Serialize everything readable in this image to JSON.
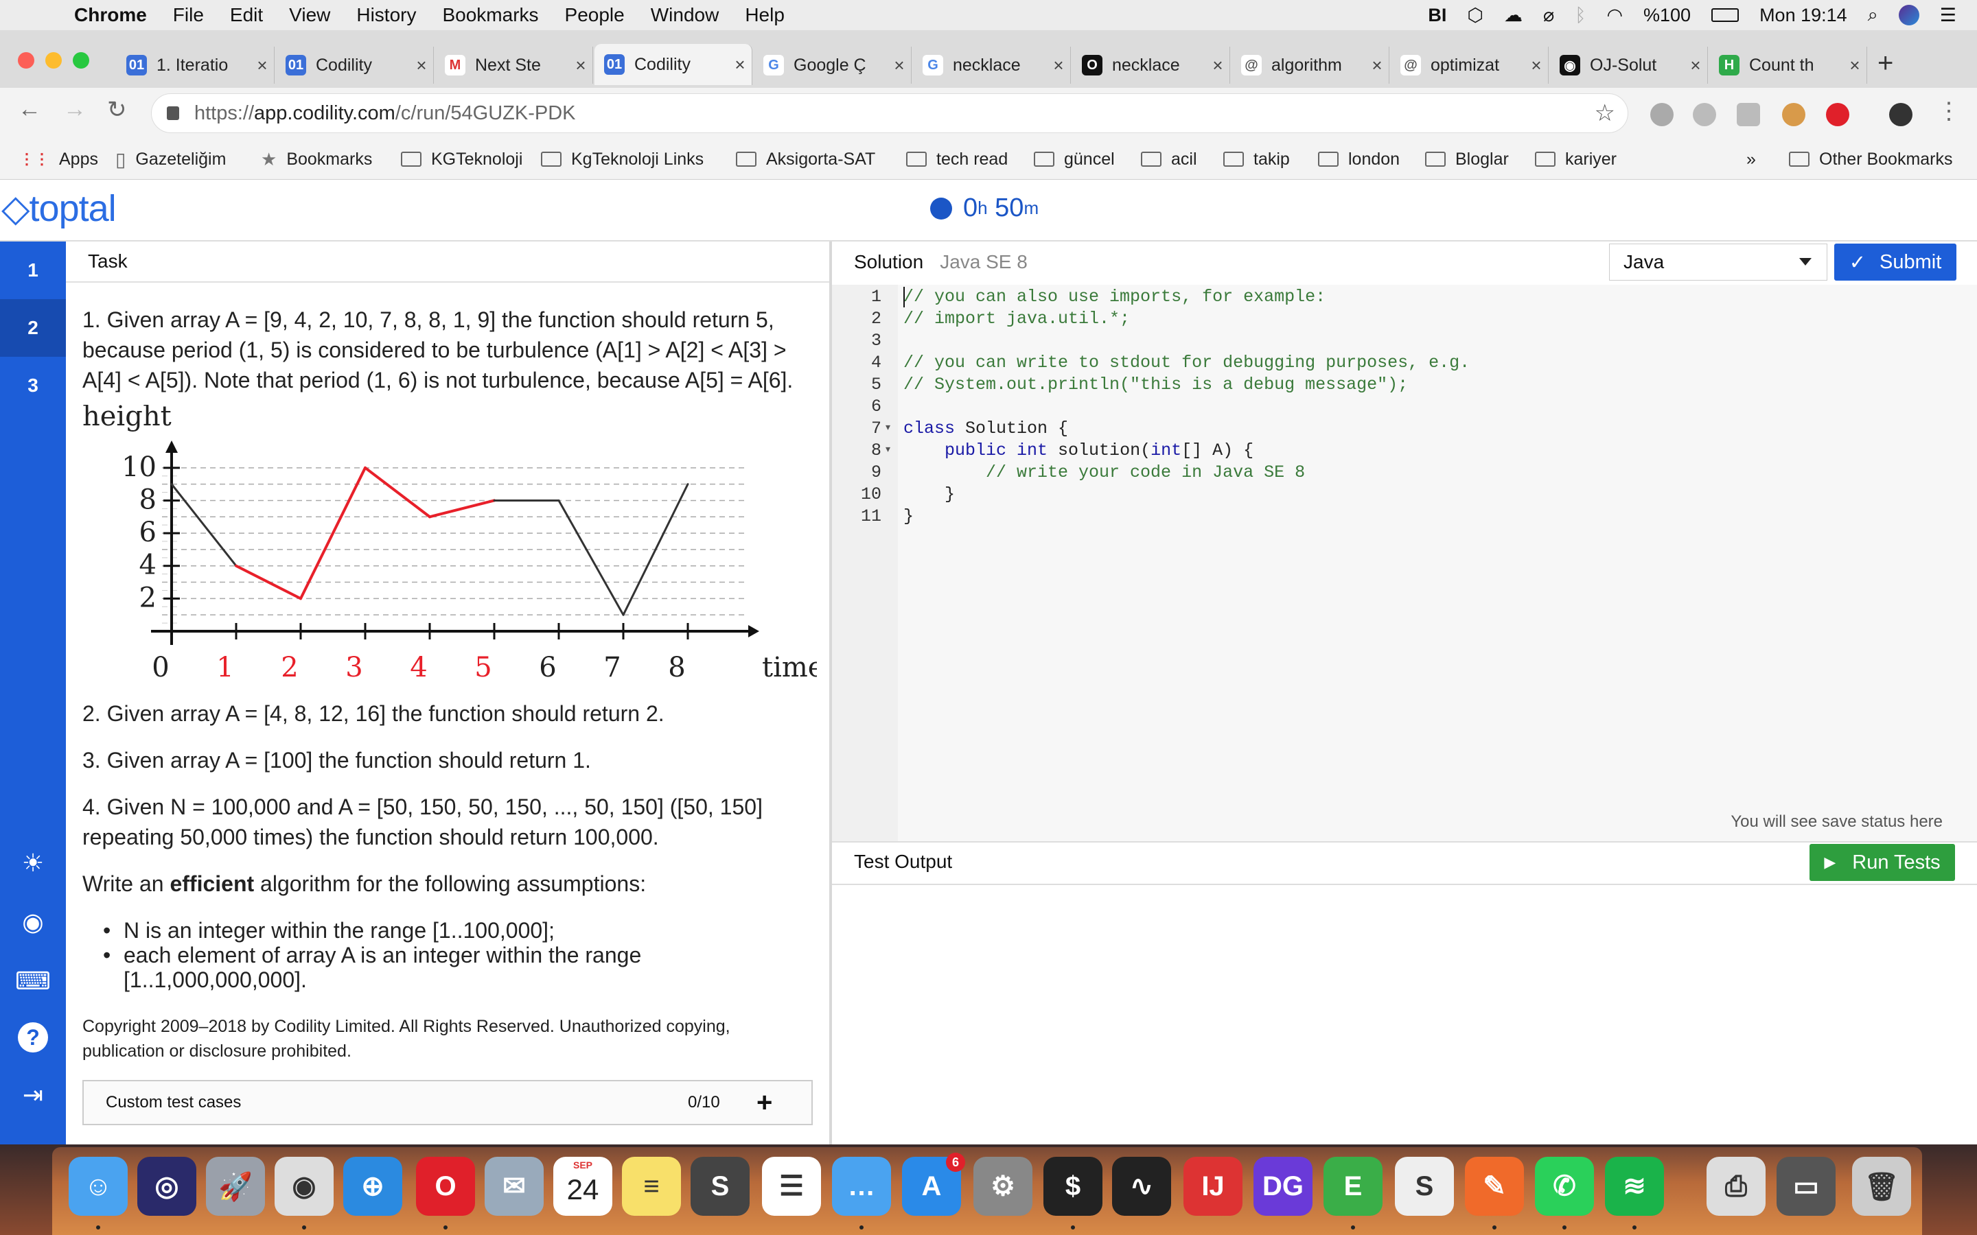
{
  "menubar": {
    "app": "Chrome",
    "items": [
      "File",
      "Edit",
      "View",
      "History",
      "Bookmarks",
      "People",
      "Window",
      "Help"
    ],
    "battery": "%100",
    "clock": "Mon 19:14"
  },
  "tabs": [
    {
      "label": "1. Iteratio",
      "icon": "01"
    },
    {
      "label": "Codility",
      "icon": "01"
    },
    {
      "label": "Next Ste",
      "icon": "M"
    },
    {
      "label": "Codility",
      "icon": "01"
    },
    {
      "label": "Google Ç",
      "icon": "G"
    },
    {
      "label": "necklace",
      "icon": "G"
    },
    {
      "label": "necklace",
      "icon": "O"
    },
    {
      "label": "algorithm",
      "icon": "@"
    },
    {
      "label": "optimizat",
      "icon": "@"
    },
    {
      "label": "OJ-Solut",
      "icon": "gh"
    },
    {
      "label": "Count th",
      "icon": "H"
    }
  ],
  "address": {
    "scheme": "https://",
    "host": "app.codility.com",
    "path": "/c/run/54GUZK-PDK"
  },
  "bookmarks": [
    "Apps",
    "Gazeteliğim",
    "Bookmarks",
    "KGTeknoloji",
    "KgTeknoloji Links",
    "Aksigorta-SAT",
    "tech read",
    "güncel",
    "acil",
    "takip",
    "london",
    "Bloglar",
    "kariyer"
  ],
  "bookmarks_more": "»",
  "bookmarks_other": "Other Bookmarks",
  "brand": "toptal",
  "timer": {
    "h": "0",
    "h_unit": "h",
    "m": "50",
    "m_unit": "m"
  },
  "sidebar": {
    "tasks": [
      "1",
      "2",
      "3"
    ]
  },
  "task": {
    "heading": "Task",
    "p1": "1. Given array A = [9, 4, 2, 10, 7, 8, 8, 1, 9] the function should return 5, because period (1, 5) is considered to be turbulence (A[1] > A[2] < A[3] > A[4] < A[5]). Note that period (1, 6) is not turbulence, because A[5] = A[6].",
    "p2": "2. Given array A = [4, 8, 12, 16] the function should return 2.",
    "p3": "3. Given array A = [100] the function should return 1.",
    "p4": "4. Given N = 100,000 and A = [50, 150, 50, 150, ..., 50, 150] ([50, 150] repeating 50,000 times) the function should return 100,000.",
    "p5_pre": "Write an ",
    "p5_bold": "efficient",
    "p5_post": " algorithm for the following assumptions:",
    "bullets": [
      "N is an integer within the range [1..100,000];",
      "each element of array A is an integer within the range [1..1,000,000,000]."
    ],
    "copyright": "Copyright 2009–2018 by Codility Limited. All Rights Reserved. Unauthorized copying, publication or disclosure prohibited.",
    "custom_tests": "Custom test cases",
    "custom_count": "0/10"
  },
  "chart_data": {
    "type": "line",
    "ylabel": "height",
    "xlabel": "time",
    "x": [
      0,
      1,
      2,
      3,
      4,
      5,
      6,
      7,
      8
    ],
    "values": [
      9,
      4,
      2,
      10,
      7,
      8,
      8,
      1,
      9
    ],
    "yticks": [
      2,
      4,
      6,
      8,
      10
    ],
    "highlight_range": [
      1,
      5
    ],
    "highlight_color": "#e8202a",
    "line_color": "#333333",
    "ylim": [
      0,
      11
    ],
    "grid": "dashed horizontal"
  },
  "solution": {
    "heading": "Solution",
    "lang_version": "Java SE 8",
    "language": "Java",
    "submit": "Submit",
    "save_status": "You will see save status here",
    "lines": [
      "// you can also use imports, for example:",
      "// import java.util.*;",
      "",
      "// you can write to stdout for debugging purposes, e.g.",
      "// System.out.println(\"this is a debug message\");",
      "",
      "class Solution {",
      "    public int solution(int[] A) {",
      "        // write your code in Java SE 8",
      "    }",
      "}"
    ]
  },
  "output": {
    "heading": "Test Output",
    "run": "Run Tests"
  },
  "dock": {
    "calendar_month": "SEP",
    "calendar_day": "24",
    "badge": "6"
  }
}
